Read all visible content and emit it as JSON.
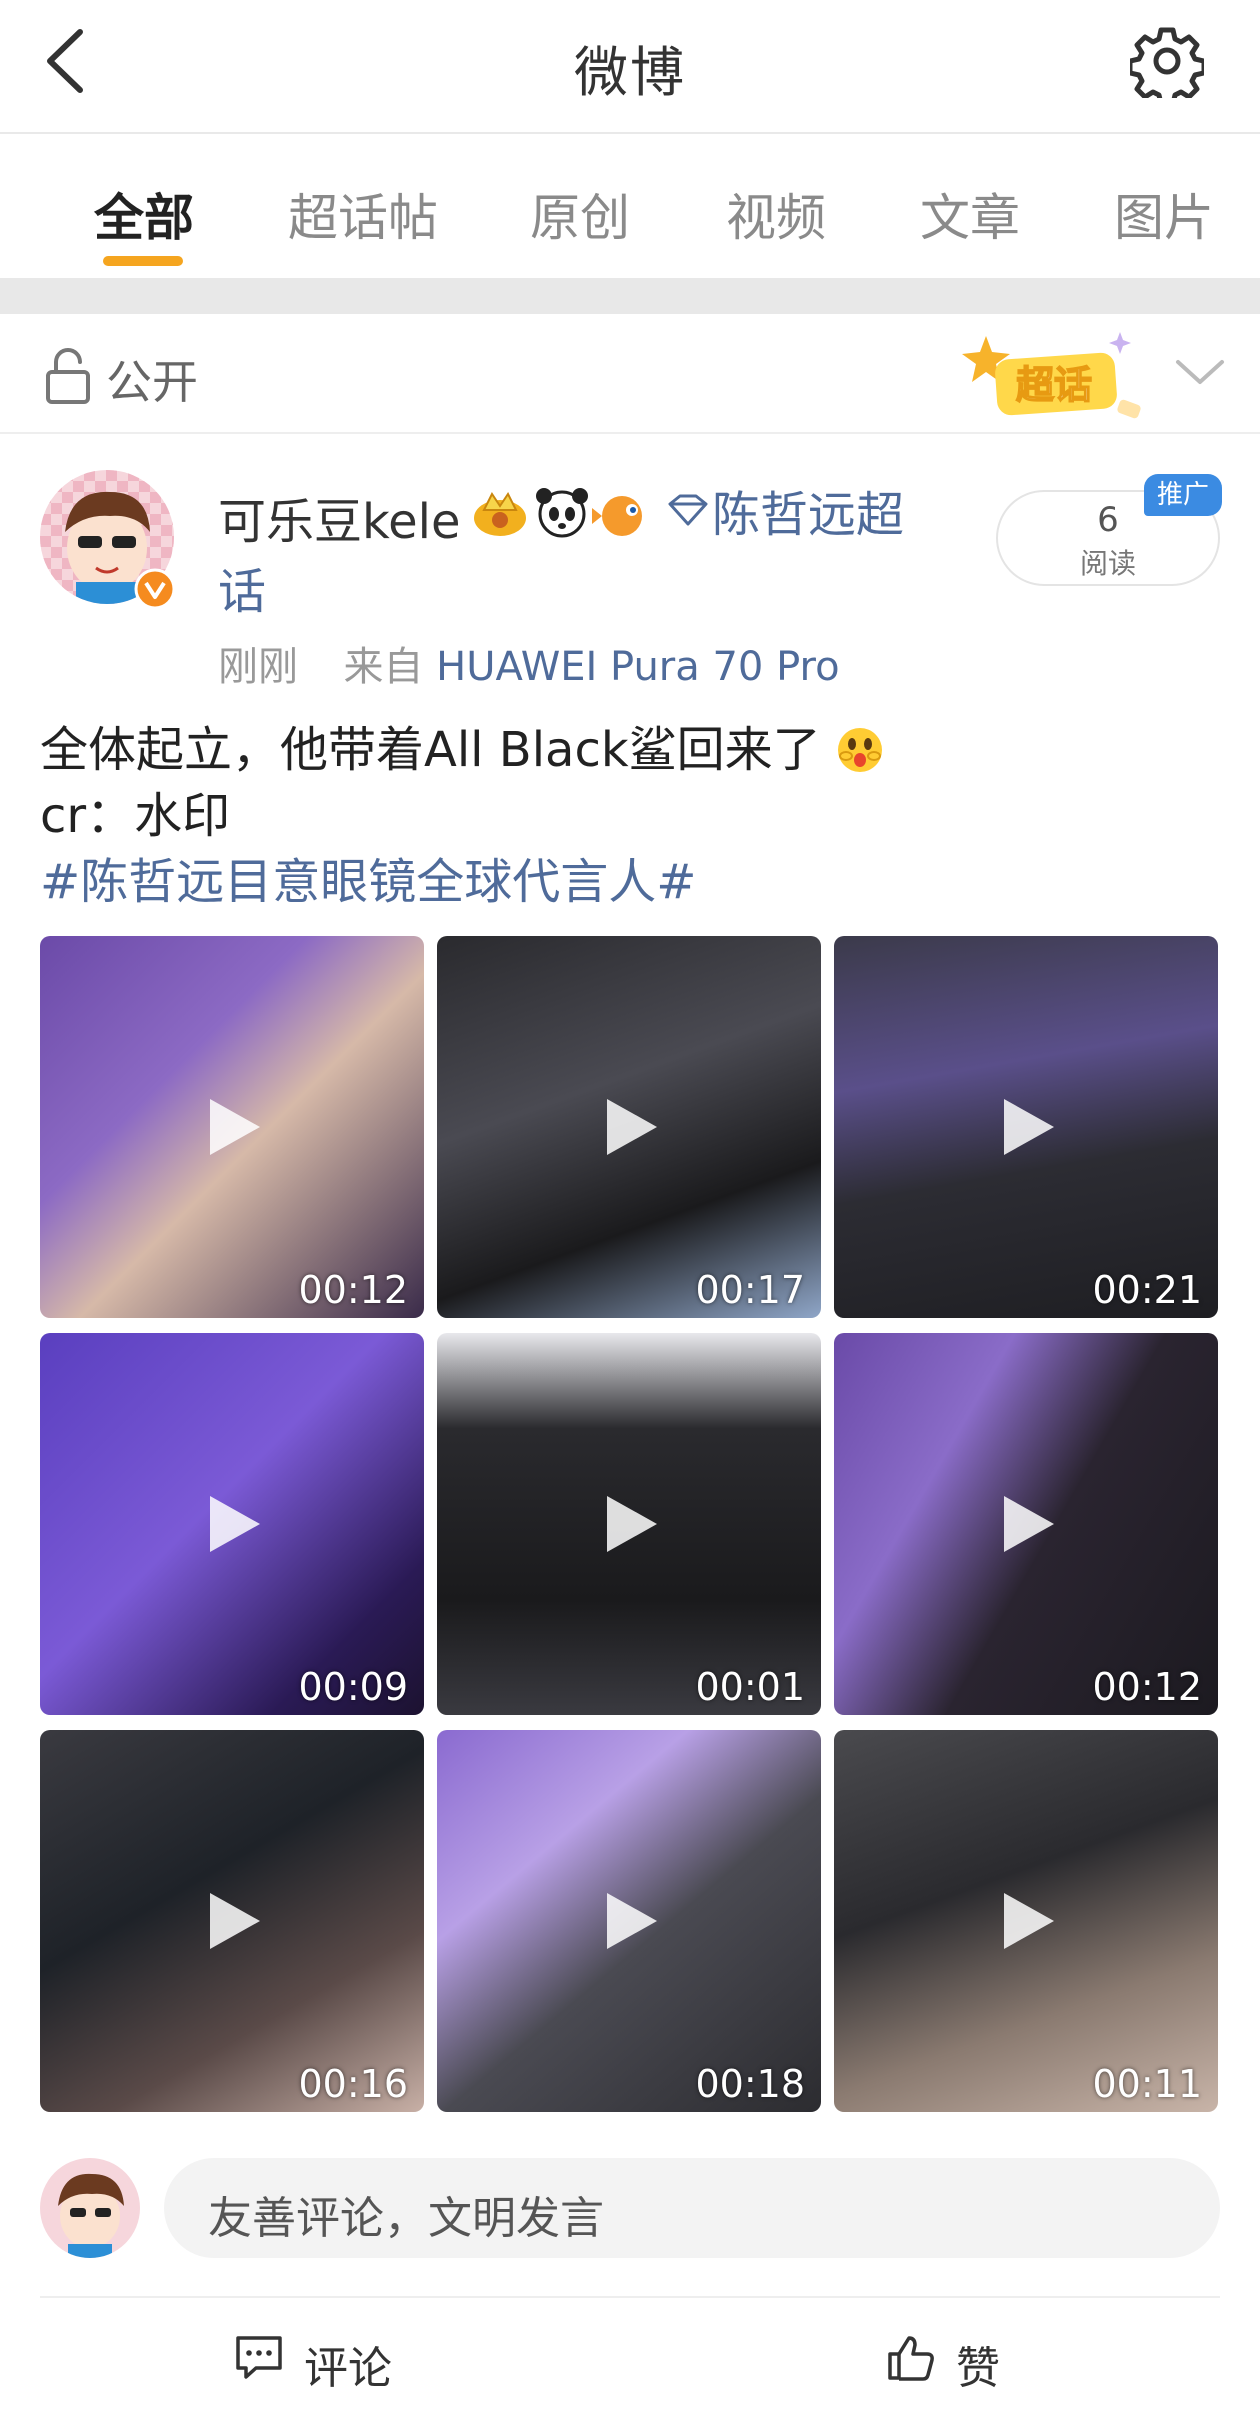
{
  "header": {
    "title": "微博"
  },
  "tabs": [
    {
      "label": "全部"
    },
    {
      "label": "超话帖"
    },
    {
      "label": "原创"
    },
    {
      "label": "视频"
    },
    {
      "label": "文章"
    },
    {
      "label": "图片"
    }
  ],
  "visibility": {
    "label": "公开",
    "badge_text": "超话"
  },
  "post": {
    "username": "可乐豆kele",
    "topic_part1": "陈哲远超",
    "topic_part2": "话",
    "read_count": "6",
    "read_label": "阅读",
    "promo_tag": "推广",
    "time": "刚刚",
    "from_label": "来自",
    "device": "HUAWEI Pura 70 Pro",
    "text_line1": "全体起立，他带着All Black鲨回来了",
    "text_line2": "cr：水印",
    "hashtag": "#陈哲远目意眼镜全球代言人#"
  },
  "videos": [
    {
      "duration": "00:12"
    },
    {
      "duration": "00:17"
    },
    {
      "duration": "00:21"
    },
    {
      "duration": "00:09"
    },
    {
      "duration": "00:01"
    },
    {
      "duration": "00:12"
    },
    {
      "duration": "00:16"
    },
    {
      "duration": "00:18"
    },
    {
      "duration": "00:11"
    }
  ],
  "comment": {
    "placeholder": "友善评论，文明发言"
  },
  "actions": {
    "comment_label": "评论",
    "like_label": "赞"
  },
  "colors": {
    "accent": "#f5a51f",
    "link": "#4f6b9a",
    "promo": "#3b8be2"
  }
}
